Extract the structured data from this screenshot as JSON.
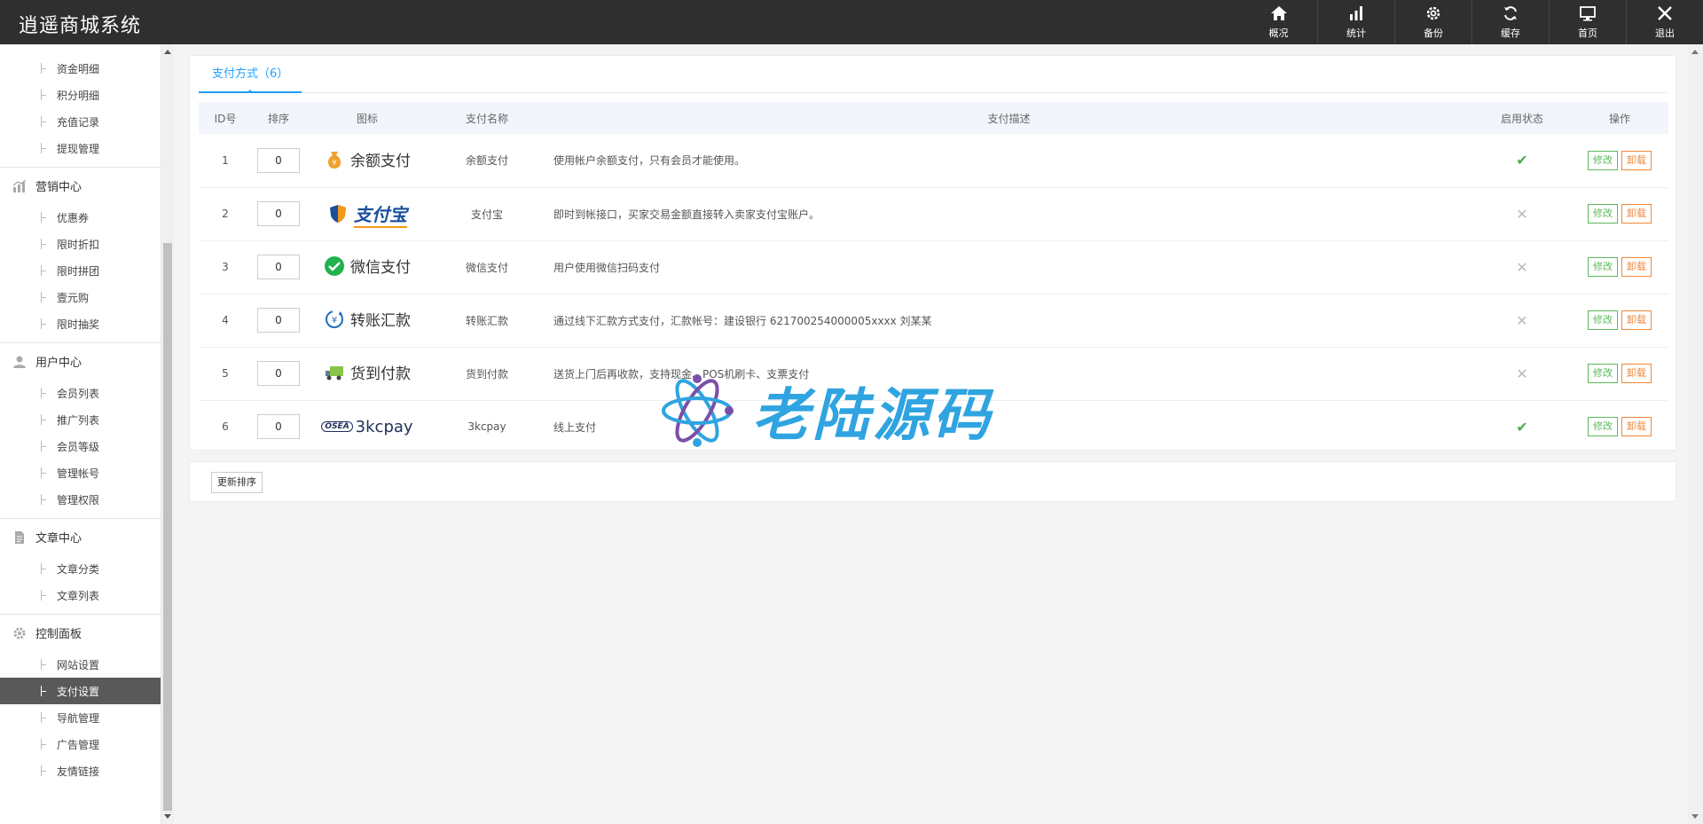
{
  "app": {
    "title": "逍遥商城系统"
  },
  "topnav": [
    {
      "label": "概况",
      "icon": "home-icon"
    },
    {
      "label": "统计",
      "icon": "bar-chart-icon"
    },
    {
      "label": "备份",
      "icon": "gear-icon"
    },
    {
      "label": "缓存",
      "icon": "refresh-icon"
    },
    {
      "label": "首页",
      "icon": "monitor-icon"
    },
    {
      "label": "退出",
      "icon": "close-icon"
    }
  ],
  "sidebar": {
    "finance_items": [
      "资金明细",
      "积分明细",
      "充值记录",
      "提现管理"
    ],
    "groups": [
      {
        "title": "营销中心",
        "icon": "chart-icon",
        "items": [
          "优惠券",
          "限时折扣",
          "限时拼团",
          "壹元购",
          "限时抽奖"
        ]
      },
      {
        "title": "用户中心",
        "icon": "user-icon",
        "items": [
          "会员列表",
          "推广列表",
          "会员等级",
          "管理帐号",
          "管理权限"
        ]
      },
      {
        "title": "文章中心",
        "icon": "document-icon",
        "items": [
          "文章分类",
          "文章列表"
        ]
      },
      {
        "title": "控制面板",
        "icon": "gear-icon",
        "items": [
          "网站设置",
          "支付设置",
          "导航管理",
          "广告管理",
          "友情链接"
        ],
        "active": "支付设置"
      }
    ]
  },
  "tab": {
    "label": "支付方式（6）"
  },
  "table": {
    "headers": [
      "ID号",
      "排序",
      "图标",
      "支付名称",
      "支付描述",
      "启用状态",
      "操作"
    ],
    "rows": [
      {
        "id": "1",
        "sort": "0",
        "logo": "余额支付",
        "name": "余额支付",
        "desc": "使用帐户余额支付，只有会员才能使用。",
        "enabled": true
      },
      {
        "id": "2",
        "sort": "0",
        "logo": "支付宝",
        "name": "支付宝",
        "desc": "即时到帐接口，买家交易金额直接转入卖家支付宝账户。",
        "enabled": false
      },
      {
        "id": "3",
        "sort": "0",
        "logo": "微信支付",
        "name": "微信支付",
        "desc": "用户使用微信扫码支付",
        "enabled": false
      },
      {
        "id": "4",
        "sort": "0",
        "logo": "转账汇款",
        "name": "转账汇款",
        "desc": "通过线下汇款方式支付，汇款帐号：建设银行 621700254000005xxxx 刘某某",
        "enabled": false
      },
      {
        "id": "5",
        "sort": "0",
        "logo": "货到付款",
        "name": "货到付款",
        "desc": "送货上门后再收款，支持现金、POS机刷卡、支票支付",
        "enabled": false
      },
      {
        "id": "6",
        "sort": "0",
        "logo": "3kcpay",
        "logo_mark": "OSEA",
        "name": "3kcpay",
        "desc": "线上支付",
        "enabled": true
      }
    ],
    "edit_label": "修改",
    "delete_label": "卸载",
    "state_on_glyph": "✔",
    "state_off_glyph": "✕"
  },
  "footer": {
    "update_label": "更新排序"
  },
  "watermark": {
    "text": "老陆源码"
  },
  "colors": {
    "topbar": "#2f2f2f",
    "accent": "#1e9fff",
    "edit": "#5cb85c",
    "delete": "#f0883a",
    "enabled": "#4caf50"
  }
}
